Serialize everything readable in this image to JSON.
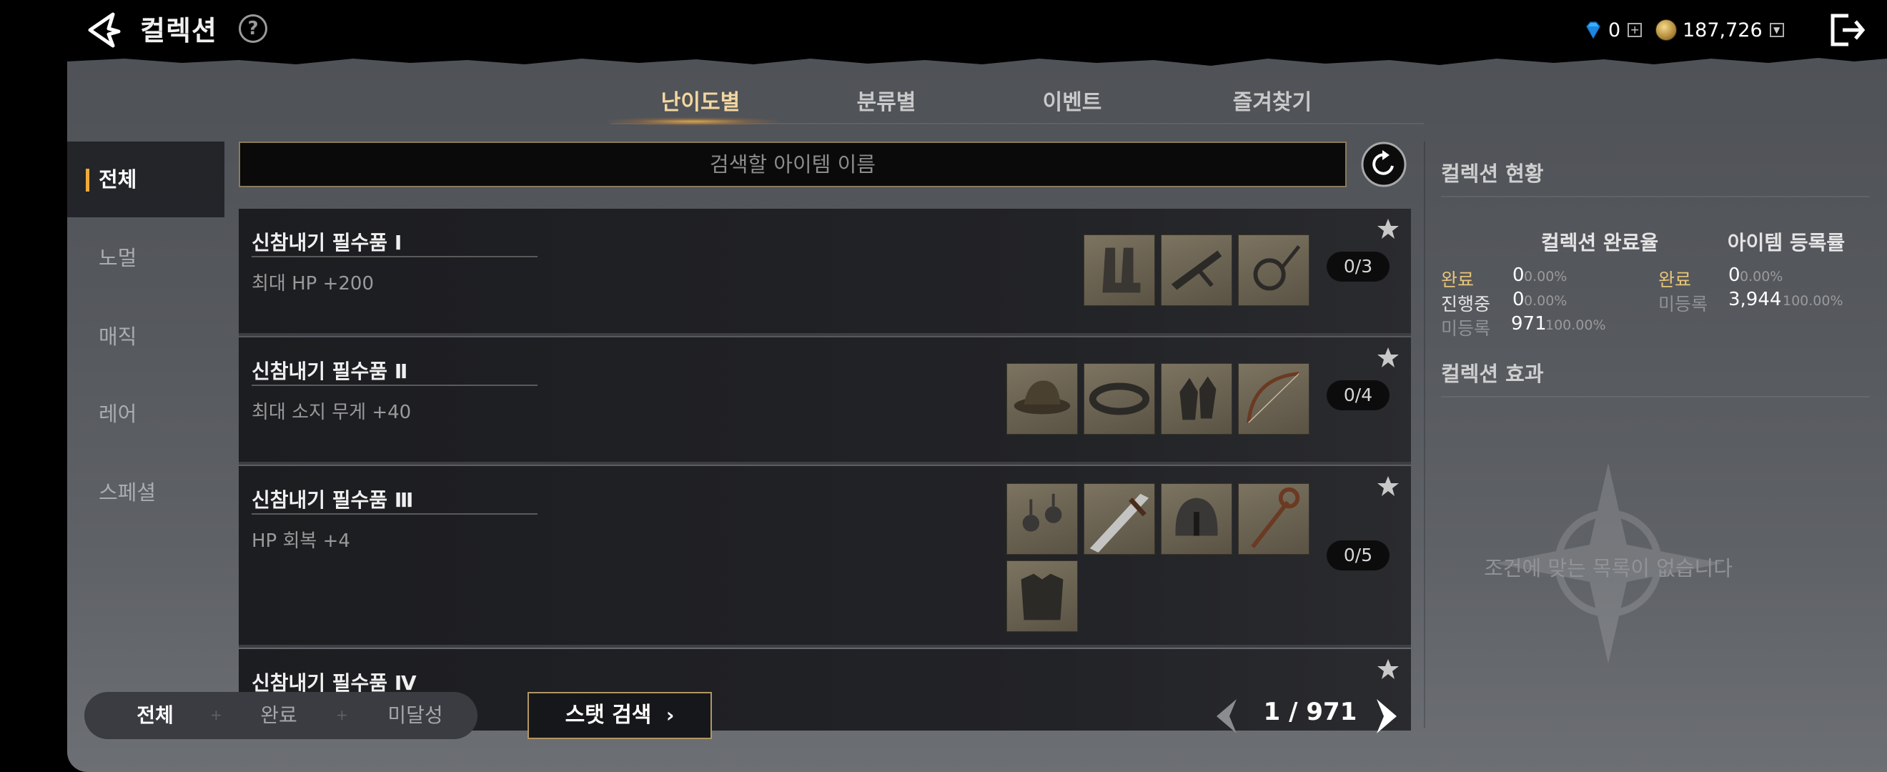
{
  "header": {
    "title": "컬렉션",
    "help_icon": "?"
  },
  "currency": {
    "gems": "0",
    "gold": "187,726"
  },
  "tabs": [
    {
      "label": "난이도별"
    },
    {
      "label": "분류별"
    },
    {
      "label": "이벤트"
    },
    {
      "label": "즐겨찾기"
    }
  ],
  "sidebar": {
    "items": [
      {
        "label": "전체"
      },
      {
        "label": "노멀"
      },
      {
        "label": "매직"
      },
      {
        "label": "레어"
      },
      {
        "label": "스페셜"
      }
    ]
  },
  "search": {
    "placeholder": "검색할 아이템 이름"
  },
  "collections": [
    {
      "title": "신참내기 필수품 Ⅰ",
      "effect": "최대 HP +200",
      "progress": "0/3"
    },
    {
      "title": "신참내기 필수품 Ⅱ",
      "effect": "최대 소지 무게 +40",
      "progress": "0/4"
    },
    {
      "title": "신참내기 필수품 Ⅲ",
      "effect": "HP 회복 +4",
      "progress": "0/5"
    },
    {
      "title": "신참내기 필수품 Ⅳ",
      "effect": "",
      "progress": ""
    }
  ],
  "status": {
    "heading": "컬렉션 현황",
    "completion": {
      "heading": "컬렉션 완료율",
      "done_label": "완료",
      "done_count": "0",
      "done_pct": "0.00%",
      "progress_label": "진행중",
      "progress_count": "0",
      "progress_pct": "0.00%",
      "unreg_label": "미등록",
      "unreg_count": "971",
      "unreg_pct": "100.00%"
    },
    "registration": {
      "heading": "아이템 등록률",
      "done_label": "완료",
      "done_count": "0",
      "done_pct": "0.00%",
      "unreg_label": "미등록",
      "unreg_count": "3,944",
      "unreg_pct": "100.00%"
    }
  },
  "effects": {
    "heading": "컬렉션 효과",
    "empty_message": "조건에 맞는 목록이 없습니다"
  },
  "filters": [
    {
      "label": "전체"
    },
    {
      "label": "완료"
    },
    {
      "label": "미달성"
    }
  ],
  "stat_search": {
    "label": "스탯 검색"
  },
  "pagination": {
    "current": "1",
    "total": "971",
    "text": "1 / 971"
  },
  "colors": {
    "accent": "#f0a93a",
    "tab_active": "#f3d7a0",
    "panel": "#55585d"
  }
}
